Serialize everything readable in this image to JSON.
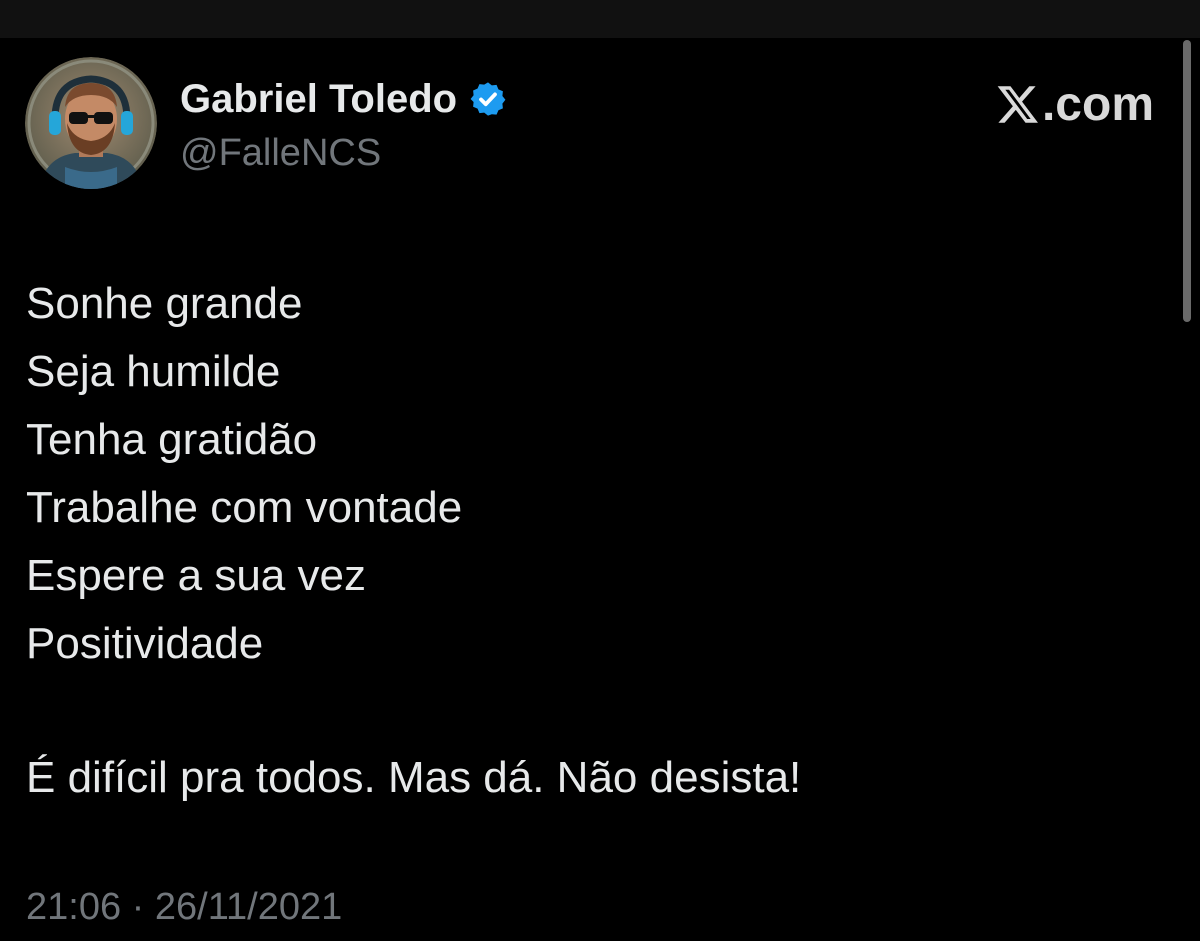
{
  "author": {
    "display_name": "Gabriel Toledo",
    "handle": "@FalleNCS",
    "verified": true
  },
  "brand": {
    "domain_text": ".com",
    "icon": "x-logo-icon"
  },
  "tweet": {
    "lines": [
      "Sonhe grande",
      "Seja humilde",
      "Tenha gratidão",
      "Trabalhe com vontade",
      "Espere a sua vez",
      "Positividade"
    ],
    "closing": "É difícil pra todos. Mas dá. Não desista!",
    "time": "21:06",
    "separator": "·",
    "date": "26/11/2021"
  },
  "colors": {
    "background": "#000000",
    "text": "#e7e9ea",
    "secondary_text": "#71767b",
    "verified_badge": "#1d9bf0"
  }
}
